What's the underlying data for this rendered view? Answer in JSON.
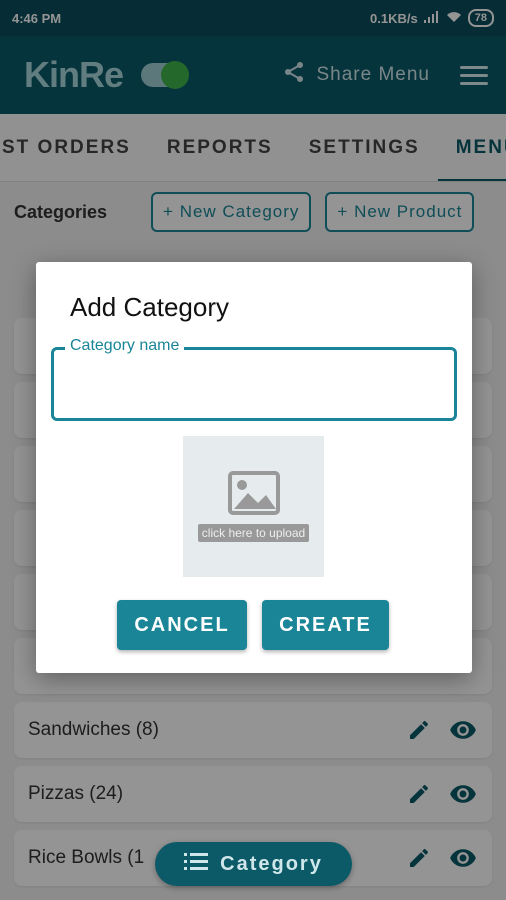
{
  "status": {
    "time": "4:46 PM",
    "speed": "0.1KB/s",
    "battery": "78"
  },
  "app": {
    "logo": "KinRe",
    "share_label": "Share Menu",
    "tabs": [
      "ST ORDERS",
      "REPORTS",
      "SETTINGS",
      "MENU"
    ],
    "active_tab": "MENU"
  },
  "actions": {
    "section_label": "Categories",
    "new_category": "+ New Category",
    "new_product": "+ New Product"
  },
  "list": [
    {
      "name": ""
    },
    {
      "name": ""
    },
    {
      "name": ""
    },
    {
      "name": ""
    },
    {
      "name": ""
    },
    {
      "name": ""
    },
    {
      "name": "Sandwiches (8)"
    },
    {
      "name": "Pizzas (24)"
    },
    {
      "name": "Rice Bowls (1"
    }
  ],
  "dialog": {
    "title": "Add Category",
    "field_label": "Category name",
    "field_value": "",
    "upload_label": "click here to upload",
    "cancel_label": "CANCEL",
    "create_label": "CREATE"
  },
  "fab": {
    "label": "Category"
  },
  "colors": {
    "primary": "#0c5a68",
    "accent": "#1a8597",
    "toggle_on": "#3fb54a"
  },
  "icons": [
    "share-icon",
    "menu-icon",
    "pencil-icon",
    "eye-icon",
    "image-icon",
    "list-icon"
  ]
}
